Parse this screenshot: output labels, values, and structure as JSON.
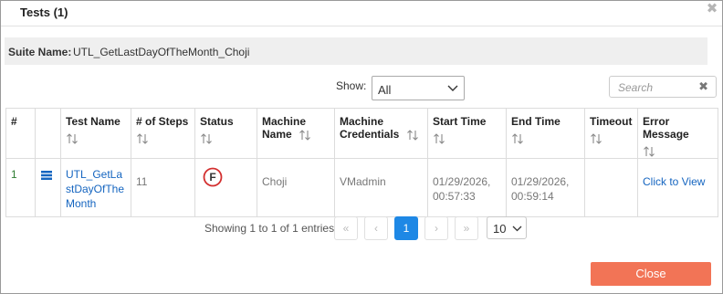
{
  "dialog": {
    "title": "Tests (1)",
    "close_glyph": "✖"
  },
  "suite": {
    "label": "Suite Name:",
    "value": "UTL_GetLastDayOfTheMonth_Choji"
  },
  "filter": {
    "show_label": "Show:",
    "show_value": "All",
    "search_placeholder": "Search",
    "search_clear_glyph": "✖"
  },
  "table": {
    "headers": [
      "#",
      "",
      "Test Name",
      "# of Steps",
      "Status",
      "Machine Name",
      "Machine Credentials",
      "Start Time",
      "End Time",
      "Timeout",
      "Error Message"
    ],
    "rows": [
      {
        "num": "1",
        "test_name_line1": "UTL_GetLa",
        "test_name_line2": "stDayOfThe",
        "test_name_line3": "Month",
        "steps": "11",
        "status": "F",
        "machine": "Choji",
        "credentials": "VMadmin",
        "start_date": "01/29/2026,",
        "start_time": "00:57:33",
        "end_date": "01/29/2026,",
        "end_time": "00:59:14",
        "timeout": "",
        "error_link": "Click to View"
      }
    ]
  },
  "pagination": {
    "info": "Showing 1 to 1 of 1 entries",
    "first": "«",
    "prev": "‹",
    "current": "1",
    "next": "›",
    "last": "»",
    "per_page": "10"
  },
  "footer": {
    "close_label": "Close"
  },
  "colors": {
    "primary": "#1e88e5",
    "close_button": "#f27456",
    "status_fail": "#d32f2f",
    "link": "#1565c0"
  }
}
